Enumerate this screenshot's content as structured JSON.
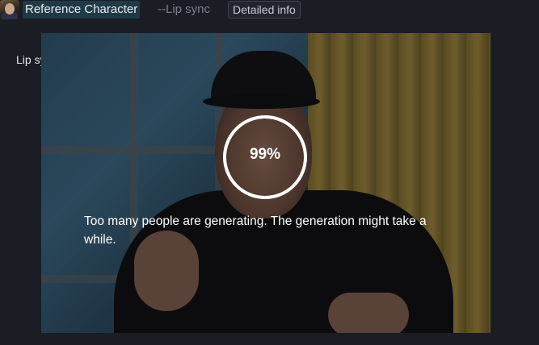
{
  "header": {
    "reference_label": "Reference Character",
    "mode_label": "--Lip sync",
    "detail_button": "Detailed info"
  },
  "side_label": "Lip sync",
  "video": {
    "progress_percent": 99,
    "progress_text": "99%",
    "notice": "Too many people are generating. The generation might take a while."
  },
  "colors": {
    "background": "#1b1d24",
    "reference_badge": "#1f3a46",
    "progress_ring": "#ffffff"
  }
}
